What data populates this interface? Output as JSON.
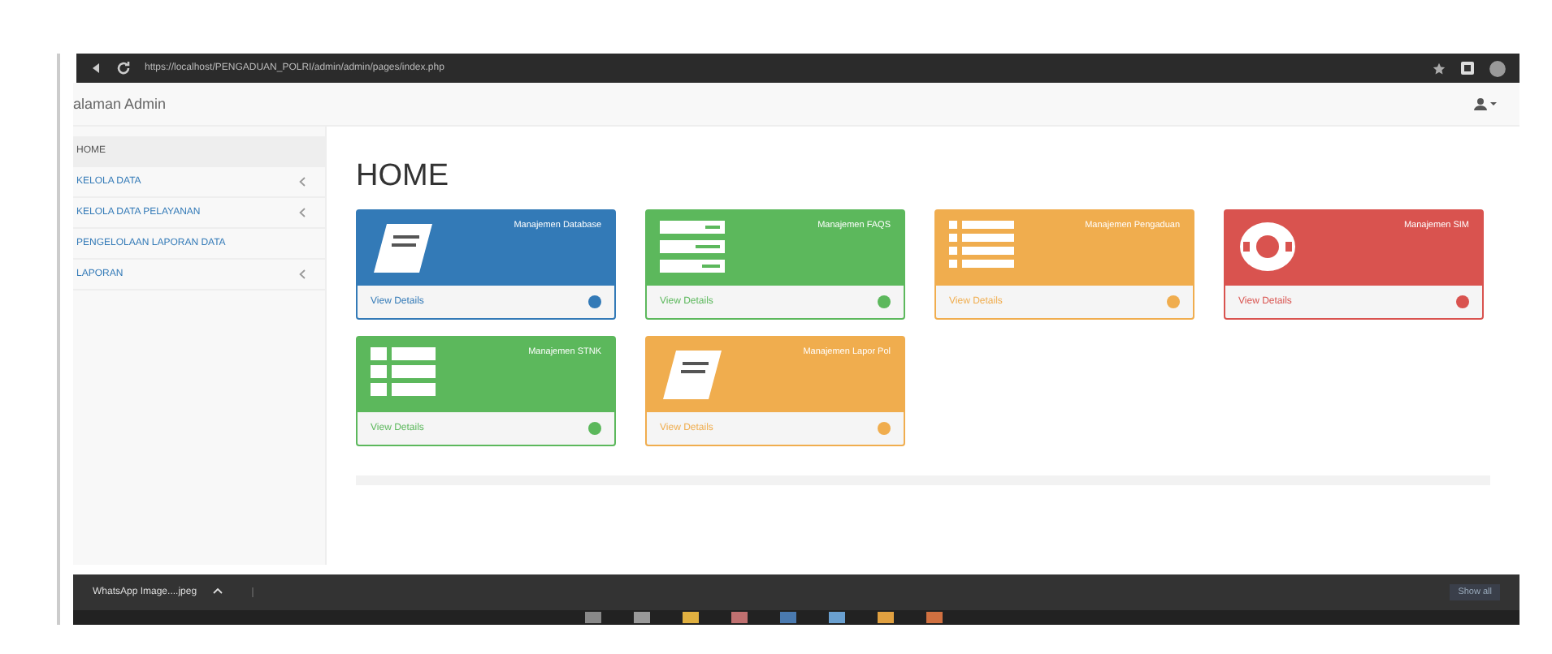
{
  "browser": {
    "url": "https://localhost/PENGADUAN_POLRI/admin/admin/pages/index.php"
  },
  "navbar": {
    "title": "alaman Admin"
  },
  "sidebar": {
    "items": [
      {
        "label": "HOME",
        "selected": true,
        "has_submenu": false
      },
      {
        "label": "KELOLA DATA",
        "selected": false,
        "has_submenu": true
      },
      {
        "label": "KELOLA DATA PELAYANAN",
        "selected": false,
        "has_submenu": true
      },
      {
        "label": "PENGELOLAAN LAPORAN DATA",
        "selected": false,
        "has_submenu": false
      },
      {
        "label": "LAPORAN",
        "selected": false,
        "has_submenu": true
      }
    ]
  },
  "page_title": "HOME",
  "cards": [
    {
      "title": "Manajemen Database",
      "link": "View Details",
      "color": "#337ab7",
      "kind": "book"
    },
    {
      "title": "Manajemen FAQS",
      "link": "View Details",
      "color": "#5cb85c",
      "kind": "form"
    },
    {
      "title": "Manajemen Pengaduan",
      "link": "View Details",
      "color": "#f0ad4e",
      "kind": "list"
    },
    {
      "title": "Manajemen SIM",
      "link": "View Details",
      "color": "#d9534f",
      "kind": "lifebuoy"
    },
    {
      "title": "Manajemen STNK",
      "link": "View Details",
      "color": "#5cb85c",
      "kind": "table"
    },
    {
      "title": "Manajemen Lapor Pol",
      "link": "View Details",
      "color": "#f0ad4e",
      "kind": "book"
    }
  ],
  "download_bar": {
    "file": "WhatsApp Image....jpeg",
    "show_all": "Show all"
  }
}
